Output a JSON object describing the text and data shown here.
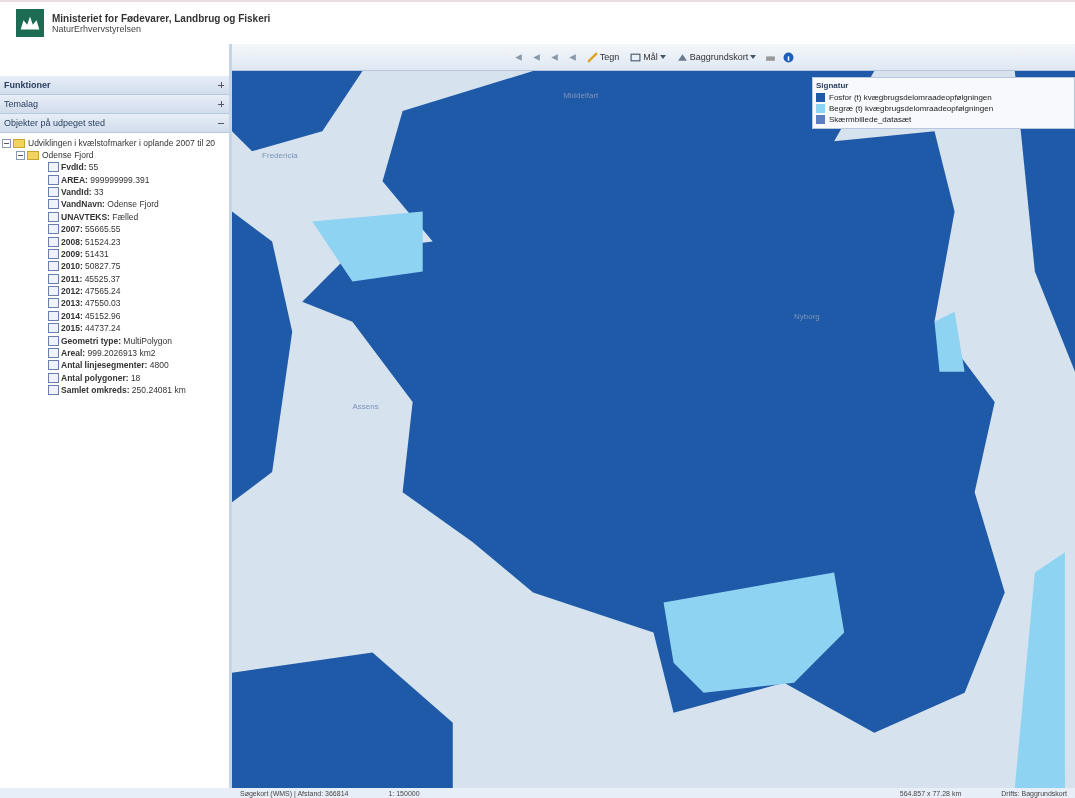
{
  "header": {
    "title": "Ministeriet for Fødevarer, Landbrug og Fiskeri",
    "subtitle": "NaturErhvervstyrelsen"
  },
  "toolbar": {
    "tools": [
      {
        "kind": "icon"
      },
      {
        "kind": "icon"
      },
      {
        "kind": "icon"
      },
      {
        "kind": "icon"
      }
    ],
    "draw_label": "Tegn",
    "measure_label": "Mål",
    "basemap_label": "Baggrundskort"
  },
  "sidebar": {
    "sections": [
      {
        "label": "Funktioner",
        "expanded": false,
        "selected": true
      },
      {
        "label": "Temalag",
        "expanded": false,
        "selected": false
      },
      {
        "label": "Objekter på udpeget sted",
        "expanded": true,
        "selected": false
      }
    ],
    "tree": [
      {
        "label": "Udviklingen i kvælstofmarker i oplande 2007 til 20",
        "expanded": true,
        "children": [
          {
            "label": "Odense Fjord",
            "expanded": true,
            "children": [
              {
                "key": "FvdId:",
                "value": "55"
              },
              {
                "key": "AREA:",
                "value": "999999999.391"
              },
              {
                "key": "VandId:",
                "value": "33"
              },
              {
                "key": "VandNavn:",
                "value": "Odense Fjord"
              },
              {
                "key": "UNAVTEKS:",
                "value": "Fælled"
              },
              {
                "key": "2007:",
                "value": "55665.55"
              },
              {
                "key": "2008:",
                "value": "51524.23"
              },
              {
                "key": "2009:",
                "value": "51431"
              },
              {
                "key": "2010:",
                "value": "50827.75"
              },
              {
                "key": "2011:",
                "value": "45525.37"
              },
              {
                "key": "2012:",
                "value": "47565.24"
              },
              {
                "key": "2013:",
                "value": "47550.03"
              },
              {
                "key": "2014:",
                "value": "45152.96"
              },
              {
                "key": "2015:",
                "value": "44737.24"
              },
              {
                "key": "Geometri type:",
                "value": "MultiPolygon"
              },
              {
                "key": "Areal:",
                "value": "999.2026913 km2"
              },
              {
                "key": "Antal linjesegmenter:",
                "value": "4800"
              },
              {
                "key": "Antal polygoner:",
                "value": "18"
              },
              {
                "key": "Samlet omkreds:",
                "value": "250.24081 km"
              }
            ]
          }
        ]
      }
    ]
  },
  "legend": {
    "title": "Signatur",
    "items": [
      {
        "label": "Fosfor (t) kvægbrugsdelomraadeopfølgningen",
        "color": "#1f5aa8"
      },
      {
        "label": "Begræ (t) kvægbrugsdelomraadeopfølgningen",
        "color": "#8fd3f2"
      },
      {
        "label": "Skærmbillede_datasæt",
        "color": "#5b7fc0"
      }
    ]
  },
  "map": {
    "place_labels": [
      "Fredericia",
      "Middelfart",
      "Nyborg",
      "Assens"
    ]
  },
  "status_bar": {
    "left": "Søgekort (WMS) | Afstand: 366814",
    "scale": "1: 150000",
    "extent": "564.857 x 77.28 km",
    "source": "Drifts: Baggrundskort"
  }
}
